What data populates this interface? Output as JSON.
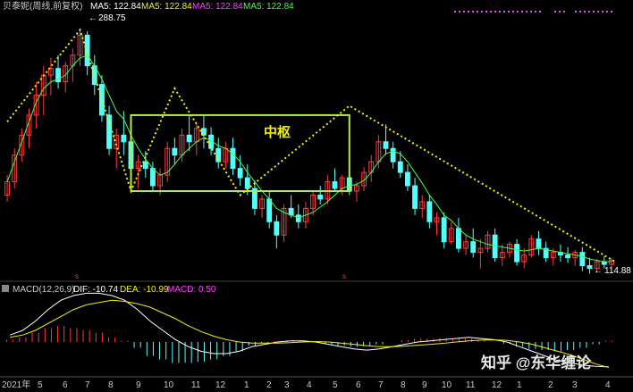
{
  "header": {
    "title": "贝泰妮(周线,前复权)",
    "ma_items": [
      {
        "label": "MA5: 122.84",
        "color": "#ffffff"
      },
      {
        "label": "MA5: 122.84",
        "color": "#f0f000"
      },
      {
        "label": "MA5: 122.84",
        "color": "#ff40ff"
      },
      {
        "label": "MA5: 122.84",
        "color": "#40ff40"
      }
    ]
  },
  "annotations": {
    "high_label": "288.75",
    "low_label": "114.88",
    "zone_label": "中枢"
  },
  "macd": {
    "title": "MACD(12,26,9)",
    "dif_label": "DIF: -10.74",
    "dea_label": "DEA: -10.99",
    "macd_label": "MACD: 0.50"
  },
  "watermark": "知乎 @东华缠论",
  "colors": {
    "up": "#ff3b3b",
    "down": "#54ffff",
    "zone": "#b4ee3c",
    "zigzag": "#f0f000",
    "ma_green": "#40ff40",
    "dif": "#ffffff",
    "dea": "#f0f000"
  },
  "chart_data": {
    "type": "candlestick",
    "price_range": [
      105,
      300
    ],
    "x_ticks": [
      "2021年",
      "5",
      "6",
      "7",
      "8",
      "9",
      "10",
      "11",
      "12",
      "1",
      "2",
      "3",
      "4",
      "5",
      "6",
      "7",
      "8",
      "9",
      "10",
      "11",
      "12",
      "1",
      "2",
      "3",
      "4"
    ],
    "ohlc": [
      [
        165,
        180,
        160,
        175
      ],
      [
        175,
        200,
        170,
        195
      ],
      [
        195,
        215,
        190,
        210
      ],
      [
        210,
        230,
        200,
        225
      ],
      [
        225,
        250,
        215,
        240
      ],
      [
        240,
        262,
        225,
        255
      ],
      [
        255,
        268,
        240,
        260
      ],
      [
        260,
        270,
        245,
        250
      ],
      [
        250,
        265,
        242,
        262
      ],
      [
        262,
        275,
        250,
        270
      ],
      [
        270,
        289,
        262,
        285
      ],
      [
        285,
        288,
        255,
        262
      ],
      [
        262,
        270,
        240,
        248
      ],
      [
        248,
        255,
        220,
        225
      ],
      [
        225,
        232,
        195,
        200
      ],
      [
        200,
        215,
        185,
        210
      ],
      [
        210,
        228,
        195,
        205
      ],
      [
        205,
        212,
        175,
        185
      ],
      [
        185,
        195,
        170,
        190
      ],
      [
        190,
        198,
        178,
        185
      ],
      [
        185,
        190,
        168,
        172
      ],
      [
        172,
        185,
        165,
        180
      ],
      [
        180,
        205,
        175,
        200
      ],
      [
        200,
        208,
        188,
        195
      ],
      [
        195,
        215,
        190,
        210
      ],
      [
        210,
        225,
        198,
        205
      ],
      [
        205,
        220,
        195,
        215
      ],
      [
        215,
        225,
        200,
        210
      ],
      [
        210,
        216,
        195,
        200
      ],
      [
        200,
        208,
        185,
        190
      ],
      [
        190,
        205,
        185,
        200
      ],
      [
        200,
        208,
        180,
        185
      ],
      [
        185,
        195,
        172,
        178
      ],
      [
        178,
        188,
        165,
        170
      ],
      [
        170,
        176,
        150,
        155
      ],
      [
        155,
        165,
        148,
        162
      ],
      [
        162,
        168,
        140,
        145
      ],
      [
        145,
        150,
        125,
        135
      ],
      [
        135,
        158,
        130,
        155
      ],
      [
        155,
        165,
        148,
        150
      ],
      [
        150,
        158,
        140,
        145
      ],
      [
        145,
        160,
        140,
        155
      ],
      [
        155,
        168,
        150,
        165
      ],
      [
        165,
        172,
        158,
        162
      ],
      [
        162,
        180,
        158,
        175
      ],
      [
        175,
        185,
        168,
        170
      ],
      [
        170,
        180,
        165,
        178
      ],
      [
        178,
        182,
        165,
        168
      ],
      [
        168,
        175,
        160,
        172
      ],
      [
        172,
        186,
        168,
        182
      ],
      [
        182,
        195,
        175,
        190
      ],
      [
        190,
        210,
        185,
        205
      ],
      [
        205,
        218,
        195,
        200
      ],
      [
        200,
        205,
        185,
        190
      ],
      [
        190,
        198,
        178,
        182
      ],
      [
        182,
        188,
        168,
        172
      ],
      [
        172,
        178,
        150,
        155
      ],
      [
        155,
        165,
        148,
        160
      ],
      [
        160,
        165,
        140,
        145
      ],
      [
        145,
        152,
        135,
        148
      ],
      [
        148,
        152,
        125,
        130
      ],
      [
        130,
        145,
        128,
        140
      ],
      [
        140,
        148,
        122,
        125
      ],
      [
        125,
        135,
        120,
        130
      ],
      [
        130,
        140,
        118,
        122
      ],
      [
        122,
        132,
        110,
        125
      ],
      [
        125,
        138,
        122,
        135
      ],
      [
        135,
        140,
        115,
        118
      ],
      [
        118,
        128,
        112,
        122
      ],
      [
        122,
        130,
        118,
        128
      ],
      [
        128,
        132,
        112,
        115
      ],
      [
        115,
        125,
        110,
        120
      ],
      [
        120,
        135,
        118,
        132
      ],
      [
        132,
        138,
        120,
        125
      ],
      [
        125,
        130,
        115,
        118
      ],
      [
        118,
        125,
        112,
        122
      ],
      [
        122,
        128,
        115,
        120
      ],
      [
        120,
        126,
        114,
        118
      ],
      [
        118,
        124,
        112,
        122
      ],
      [
        122,
        126,
        108,
        112
      ],
      [
        112,
        118,
        106,
        110
      ],
      [
        110,
        117,
        107,
        115
      ],
      [
        115,
        119,
        110,
        113
      ],
      [
        113,
        118,
        111,
        116
      ]
    ],
    "ma_green": [
      175,
      190,
      205,
      220,
      235,
      245,
      250,
      252,
      255,
      262,
      268,
      270,
      262,
      252,
      240,
      228,
      222,
      210,
      200,
      192,
      185,
      180,
      182,
      188,
      195,
      200,
      205,
      208,
      206,
      202,
      200,
      196,
      190,
      182,
      175,
      168,
      162,
      155,
      152,
      150,
      148,
      150,
      152,
      156,
      160,
      165,
      170,
      172,
      173,
      176,
      182,
      190,
      196,
      198,
      196,
      190,
      182,
      174,
      165,
      158,
      150,
      146,
      140,
      135,
      132,
      130,
      128,
      127,
      126,
      125,
      124,
      123,
      124,
      125,
      124,
      123,
      122,
      121,
      120,
      119,
      117,
      116,
      115,
      115
    ],
    "zigzag": [
      [
        0.5,
        220
      ],
      [
        10.5,
        289
      ],
      [
        17.5,
        168
      ],
      [
        23.5,
        245
      ],
      [
        32.5,
        165
      ],
      [
        47.5,
        232
      ],
      [
        84,
        115
      ]
    ],
    "zone": {
      "x_from": 17.5,
      "x_to": 47.5,
      "price_low": 168,
      "price_high": 225
    },
    "macd": {
      "dif": [
        3,
        5,
        9,
        14,
        18,
        20,
        21,
        21,
        20,
        18,
        14,
        9,
        5,
        1,
        -2,
        -4,
        -5,
        -5,
        -4,
        -2,
        -1,
        0,
        0.5,
        0.5,
        0,
        -1,
        -2,
        -3,
        -3.5,
        -3,
        -2,
        -1,
        0,
        0.5,
        1,
        1.5,
        2,
        1.5,
        1,
        0,
        -2,
        -4,
        -6,
        -8,
        -9,
        -10,
        -10.5,
        -10.74
      ],
      "dea": [
        2,
        3,
        5,
        8,
        11,
        14,
        16,
        17,
        18,
        17.5,
        16.5,
        15,
        12.5,
        10,
        7,
        4.5,
        2.5,
        1,
        0,
        -0.5,
        -0.5,
        -0.5,
        -0.3,
        0,
        0.2,
        0,
        -0.5,
        -1,
        -1.6,
        -2,
        -2,
        -1.8,
        -1.4,
        -1,
        -0.6,
        0,
        0.5,
        0.8,
        0.9,
        0.7,
        0,
        -1,
        -2.5,
        -4,
        -5.5,
        -7.5,
        -9.5,
        -10.99
      ],
      "hist": [
        1,
        2,
        4,
        6,
        7,
        6,
        5,
        4,
        2,
        0.5,
        -2.5,
        -6,
        -7.5,
        -9,
        -9,
        -8.5,
        -7.5,
        -6,
        -4,
        -1.5,
        -0.5,
        0.5,
        0.8,
        0.5,
        -0.2,
        -1,
        -1.5,
        -2,
        -1.9,
        -1,
        0,
        0.8,
        1.4,
        1.5,
        1.6,
        1.5,
        1.5,
        0.7,
        0.1,
        -0.7,
        -2,
        -3,
        -3.5,
        -4,
        -3.5,
        -2.5,
        -1,
        0.5
      ]
    }
  }
}
